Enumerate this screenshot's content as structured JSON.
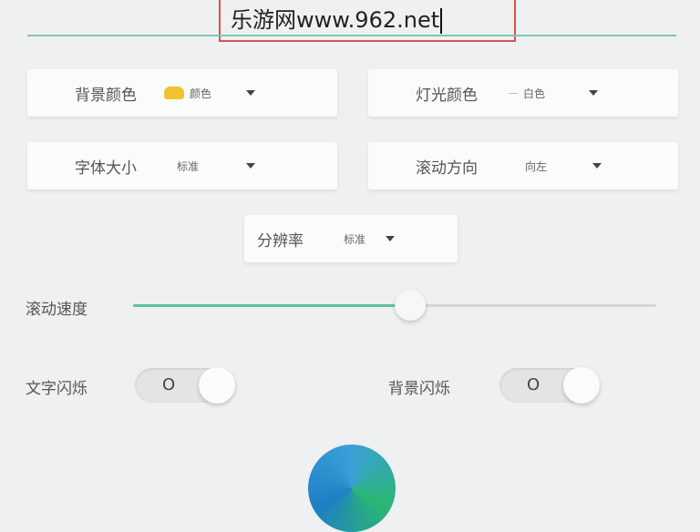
{
  "marquee_text": {
    "value": "乐游网www.962.net"
  },
  "selectors": {
    "bg_color": {
      "label": "背景颜色",
      "value": "颜色"
    },
    "light_color": {
      "label": "灯光颜色",
      "value": "白色"
    },
    "font_size": {
      "label": "字体大小",
      "value": "标准"
    },
    "scroll_direction": {
      "label": "滚动方向",
      "value": "向左"
    },
    "resolution": {
      "label": "分辨率",
      "value": "标准"
    }
  },
  "scroll_speed": {
    "label": "滚动速度",
    "level_percent": 53
  },
  "toggles": {
    "text_flash": {
      "label": "文字闪烁",
      "state_text": "O"
    },
    "bg_flash": {
      "label": "背景闪烁",
      "state_text": "O"
    }
  },
  "colors": {
    "accent": "#5cbfa0",
    "highlight_box": "#d9534f",
    "bg_swatch": "#f2c12e"
  }
}
